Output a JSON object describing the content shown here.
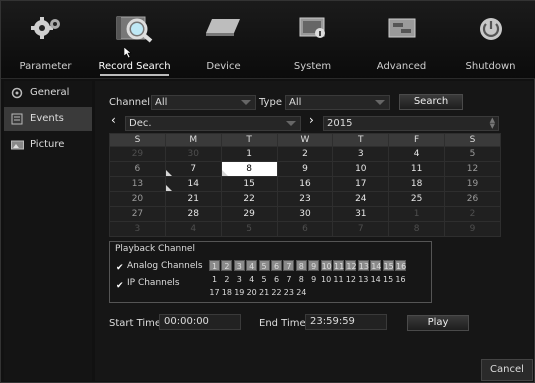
{
  "nav": {
    "items": [
      {
        "label": "Parameter",
        "icon": "gears-icon"
      },
      {
        "label": "Record Search",
        "icon": "record-search-icon"
      },
      {
        "label": "Device",
        "icon": "hdd-icon"
      },
      {
        "label": "System",
        "icon": "system-monitor-icon"
      },
      {
        "label": "Advanced",
        "icon": "advanced-toolbox-icon"
      },
      {
        "label": "Shutdown",
        "icon": "power-icon"
      }
    ],
    "active_index": 1
  },
  "sidebar": {
    "items": [
      {
        "label": "General",
        "icon": "general-icon"
      },
      {
        "label": "Events",
        "icon": "events-icon"
      },
      {
        "label": "Picture",
        "icon": "picture-icon"
      }
    ]
  },
  "search": {
    "channel_label": "Channel",
    "channel_value": "All",
    "type_label": "Type",
    "type_value": "All",
    "search_button": "Search",
    "month": "Dec.",
    "year": "2015"
  },
  "calendar": {
    "headers": [
      "S",
      "M",
      "T",
      "W",
      "T",
      "F",
      "S"
    ],
    "rows": [
      [
        "29",
        "30",
        "1",
        "2",
        "3",
        "4",
        "5"
      ],
      [
        "6",
        "7",
        "8",
        "9",
        "10",
        "11",
        "12"
      ],
      [
        "13",
        "14",
        "15",
        "16",
        "17",
        "18",
        "19"
      ],
      [
        "20",
        "21",
        "22",
        "23",
        "24",
        "25",
        "26"
      ],
      [
        "27",
        "28",
        "29",
        "30",
        "31",
        "1",
        "2"
      ],
      [
        "3",
        "4",
        "5",
        "6",
        "7",
        "8",
        "9"
      ]
    ],
    "selected": "8",
    "recorded_days": [
      "7",
      "8",
      "14"
    ]
  },
  "playback": {
    "title": "Playback Channel",
    "analog_label": "Analog Channels",
    "ip_label": "IP Channels",
    "analog_channels": [
      "1",
      "2",
      "3",
      "4",
      "5",
      "6",
      "7",
      "8",
      "9",
      "10",
      "11",
      "12",
      "13",
      "14",
      "15",
      "16"
    ],
    "ip_channels_row1": [
      "1",
      "2",
      "3",
      "4",
      "5",
      "6",
      "7",
      "8",
      "9",
      "10",
      "11",
      "12",
      "13",
      "14",
      "15",
      "16"
    ],
    "ip_channels_row2": [
      "17",
      "18",
      "19",
      "20",
      "21",
      "22",
      "23",
      "24"
    ]
  },
  "time": {
    "start_label": "Start Time",
    "start_value": "00:00:00",
    "end_label": "End Time",
    "end_value": "23:59:59",
    "play_button": "Play"
  },
  "cancel_button": "Cancel",
  "colors": {
    "background": "#111111",
    "active_tab": "#3a3a3a",
    "selected_day": "#ffffff"
  }
}
